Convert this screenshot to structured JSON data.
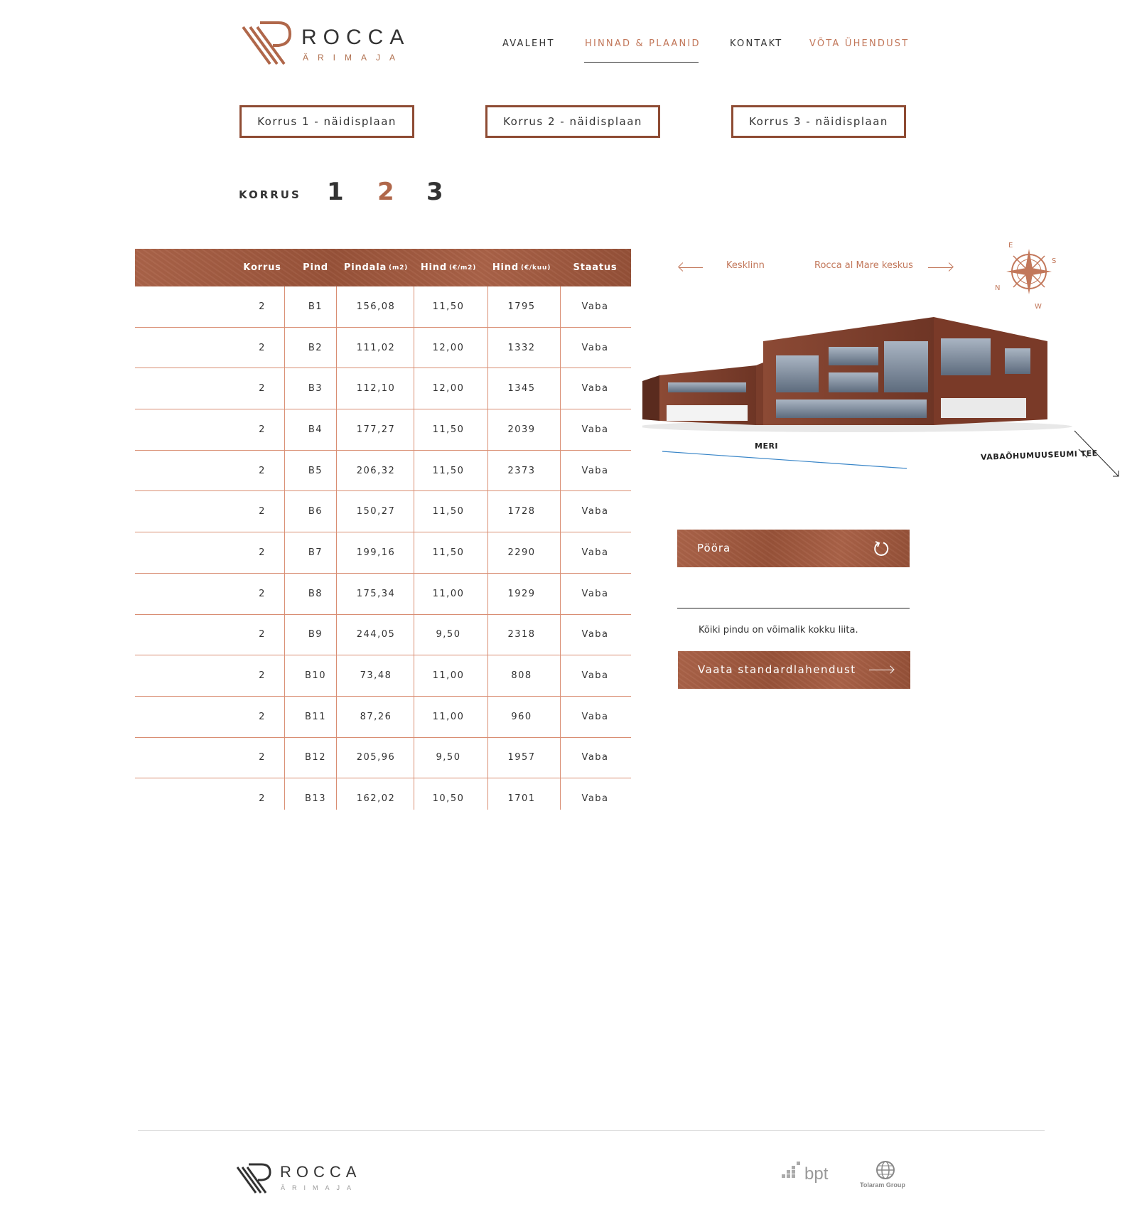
{
  "header": {
    "logo_name": "ROCCA",
    "logo_sub": "ÄRIMAJA",
    "nav": [
      {
        "label": "AVALEHT"
      },
      {
        "label": "HINNAD & PLAANID"
      },
      {
        "label": "KONTAKT"
      },
      {
        "label": "VÕTA ÜHENDUST"
      }
    ]
  },
  "plans": [
    {
      "label": "Korrus 1  - näidisplaan"
    },
    {
      "label": "Korrus 2  - näidisplaan"
    },
    {
      "label": "Korrus 3  - näidisplaan"
    }
  ],
  "floor_selector": {
    "label": "KORRUS",
    "floors": [
      "1",
      "2",
      "3"
    ],
    "active": "2"
  },
  "table": {
    "headers": [
      {
        "label": "Korrus",
        "unit": ""
      },
      {
        "label": "Pind",
        "unit": ""
      },
      {
        "label": "Pindala",
        "unit": "(m2)"
      },
      {
        "label": "Hind",
        "unit": "(€/m2)"
      },
      {
        "label": "Hind",
        "unit": "(€/kuu)"
      },
      {
        "label": "Staatus",
        "unit": ""
      }
    ],
    "rows": [
      [
        "2",
        "B1",
        "156,08",
        "11,50",
        "1795",
        "Vaba"
      ],
      [
        "2",
        "B2",
        "111,02",
        "12,00",
        "1332",
        "Vaba"
      ],
      [
        "2",
        "B3",
        "112,10",
        "12,00",
        "1345",
        "Vaba"
      ],
      [
        "2",
        "B4",
        "177,27",
        "11,50",
        "2039",
        "Vaba"
      ],
      [
        "2",
        "B5",
        "206,32",
        "11,50",
        "2373",
        "Vaba"
      ],
      [
        "2",
        "B6",
        "150,27",
        "11,50",
        "1728",
        "Vaba"
      ],
      [
        "2",
        "B7",
        "199,16",
        "11,50",
        "2290",
        "Vaba"
      ],
      [
        "2",
        "B8",
        "175,34",
        "11,00",
        "1929",
        "Vaba"
      ],
      [
        "2",
        "B9",
        "244,05",
        "9,50",
        "2318",
        "Vaba"
      ],
      [
        "2",
        "B10",
        "73,48",
        "11,00",
        "808",
        "Vaba"
      ],
      [
        "2",
        "B11",
        "87,26",
        "11,00",
        "960",
        "Vaba"
      ],
      [
        "2",
        "B12",
        "205,96",
        "9,50",
        "1957",
        "Vaba"
      ],
      [
        "2",
        "B13",
        "162,02",
        "10,50",
        "1701",
        "Vaba"
      ]
    ]
  },
  "directions": {
    "left": "Kesklinn",
    "right": "Rocca al Mare keskus"
  },
  "compass_letters": [
    "E",
    "S",
    "W",
    "N"
  ],
  "map_labels": {
    "meri": "MERI",
    "road": "VABAÕHUMUUSEUMI TEE"
  },
  "rotate_button": "Pööra",
  "note": "Kõiki pindu on võimalik kokku liita.",
  "standard_button": "Vaata standardlahendust",
  "footer": {
    "logo_name": "ROCCA",
    "logo_sub": "ÄRIMAJA",
    "partner1": "bpt",
    "partner2": "Tolaram Group"
  },
  "colors": {
    "accent": "#c2775a",
    "copper": "#a65a3e",
    "table_line": "#d98e73"
  }
}
